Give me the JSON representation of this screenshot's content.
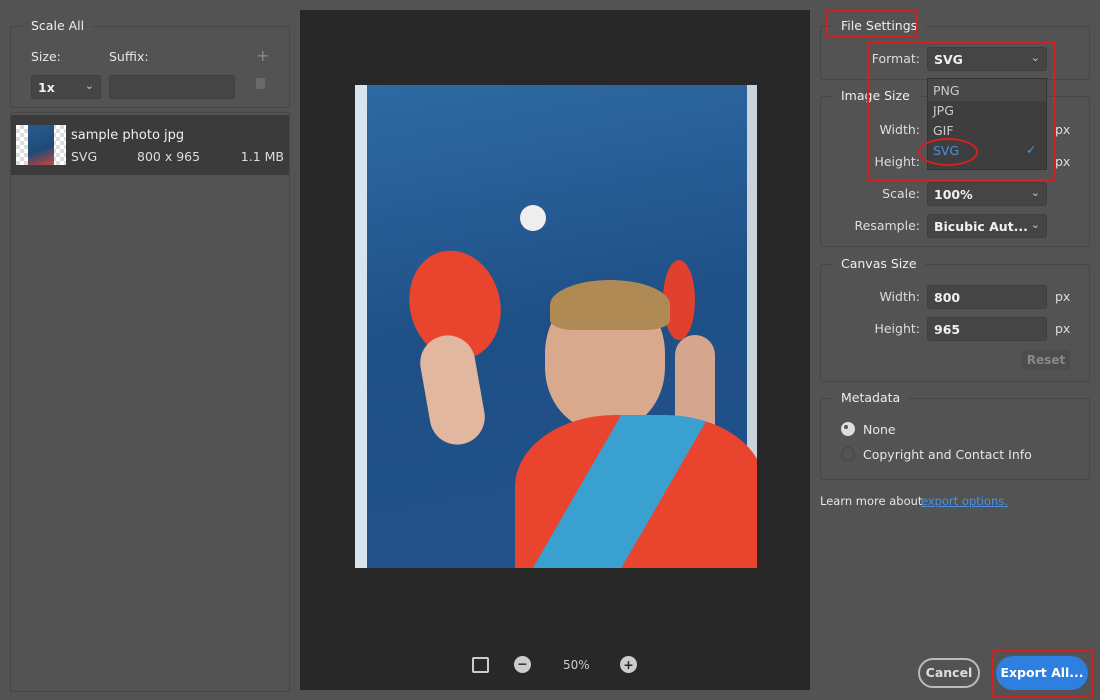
{
  "scale_all": {
    "title": "Scale All",
    "size_label": "Size:",
    "suffix_label": "Suffix:",
    "size_value": "1x",
    "suffix_value": ""
  },
  "asset": {
    "name": "sample photo jpg",
    "format": "SVG",
    "dimensions": "800 x 965",
    "file_size": "1.1 MB"
  },
  "preview": {
    "zoom": "50%"
  },
  "file_settings": {
    "title": "File Settings",
    "format_label": "Format:",
    "format_value": "SVG",
    "options": [
      "PNG",
      "JPG",
      "GIF",
      "SVG"
    ],
    "selected": "SVG"
  },
  "image_size": {
    "title": "Image Size",
    "width_label": "Width:",
    "height_label": "Height:",
    "unit": "px",
    "scale_label": "Scale:",
    "scale_value": "100%",
    "resample_label": "Resample:",
    "resample_value": "Bicubic Aut..."
  },
  "canvas_size": {
    "title": "Canvas Size",
    "width_label": "Width:",
    "width_value": "800",
    "height_label": "Height:",
    "height_value": "965",
    "unit": "px",
    "reset_label": "Reset"
  },
  "metadata": {
    "title": "Metadata",
    "options": [
      "None",
      "Copyright and Contact Info"
    ],
    "selected": "None"
  },
  "learn_more": {
    "text": "Learn more about",
    "link": "export options."
  },
  "footer": {
    "cancel": "Cancel",
    "export": "Export All..."
  },
  "colors": {
    "accent": "#2d7fe0",
    "highlight": "#d42020"
  }
}
